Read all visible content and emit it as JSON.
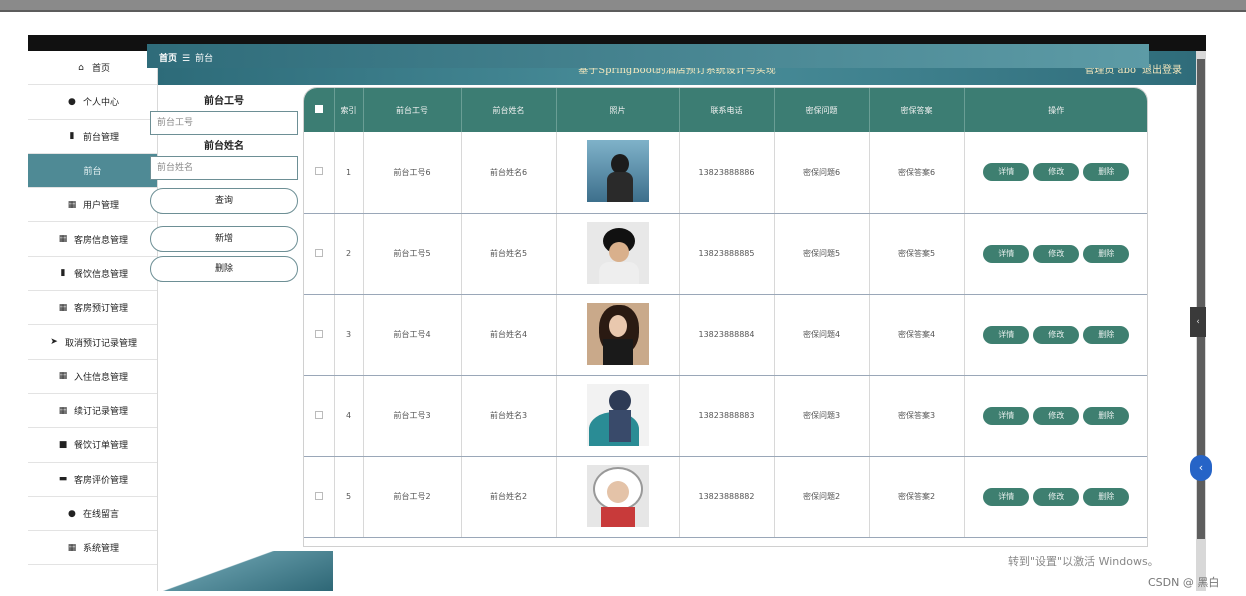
{
  "header": {
    "title": "基于SpringBoot的酒店预订系统设计与实现",
    "user": "管理员 abo",
    "logout": "退出登录"
  },
  "sidebar": {
    "items": [
      {
        "label": "首页",
        "icon": "home-icon",
        "glyph": "⌂"
      },
      {
        "label": "个人中心",
        "icon": "person-icon",
        "glyph": "●"
      },
      {
        "label": "前台管理",
        "icon": "bar-chart-icon",
        "glyph": "▮"
      },
      {
        "label": "前台",
        "icon": "",
        "glyph": ""
      },
      {
        "label": "用户管理",
        "icon": "grid-icon",
        "glyph": "▦"
      },
      {
        "label": "客房信息管理",
        "icon": "grid-icon",
        "glyph": "▦"
      },
      {
        "label": "餐饮信息管理",
        "icon": "chart-icon",
        "glyph": "▮"
      },
      {
        "label": "客房预订管理",
        "icon": "grid-icon",
        "glyph": "▦"
      },
      {
        "label": "取消预订记录管理",
        "icon": "send-icon",
        "glyph": "➤"
      },
      {
        "label": "入住信息管理",
        "icon": "grid-icon",
        "glyph": "▦"
      },
      {
        "label": "续订记录管理",
        "icon": "grid-icon",
        "glyph": "▦"
      },
      {
        "label": "餐饮订单管理",
        "icon": "box-icon",
        "glyph": "■"
      },
      {
        "label": "客房评价管理",
        "icon": "briefcase-icon",
        "glyph": "▬"
      },
      {
        "label": "在线留言",
        "icon": "pin-icon",
        "glyph": "●"
      },
      {
        "label": "系统管理",
        "icon": "table-icon",
        "glyph": "▦"
      }
    ]
  },
  "breadcrumb": {
    "home": "首页",
    "sep": "☰",
    "current": "前台"
  },
  "search": {
    "label1": "前台工号",
    "placeholder1": "前台工号",
    "label2": "前台姓名",
    "placeholder2": "前台姓名",
    "query": "查询",
    "add": "新增",
    "delete": "删除"
  },
  "table": {
    "headers": [
      "索引",
      "前台工号",
      "前台姓名",
      "照片",
      "联系电话",
      "密保问题",
      "密保答案",
      "操作"
    ],
    "ops": [
      "详情",
      "修改",
      "删除"
    ],
    "rows": [
      {
        "index": "1",
        "no": "前台工号6",
        "name": "前台姓名6",
        "phone": "13823888886",
        "q": "密保问题6",
        "a": "密保答案6"
      },
      {
        "index": "2",
        "no": "前台工号5",
        "name": "前台姓名5",
        "phone": "13823888885",
        "q": "密保问题5",
        "a": "密保答案5"
      },
      {
        "index": "3",
        "no": "前台工号4",
        "name": "前台姓名4",
        "phone": "13823888884",
        "q": "密保问题4",
        "a": "密保答案4"
      },
      {
        "index": "4",
        "no": "前台工号3",
        "name": "前台姓名3",
        "phone": "13823888883",
        "q": "密保问题3",
        "a": "密保答案3"
      },
      {
        "index": "5",
        "no": "前台工号2",
        "name": "前台姓名2",
        "phone": "13823888882",
        "q": "密保问题2",
        "a": "密保答案2"
      }
    ]
  },
  "overlay": {
    "watermark": "转到\"设置\"以激活 Windows。",
    "csdn": "CSDN @ 黑白"
  },
  "colors": {
    "sidebar_active": "#4f8a95",
    "header": "#2d6b79",
    "table_header": "#3c7d73",
    "op_button": "#3e7f70"
  }
}
